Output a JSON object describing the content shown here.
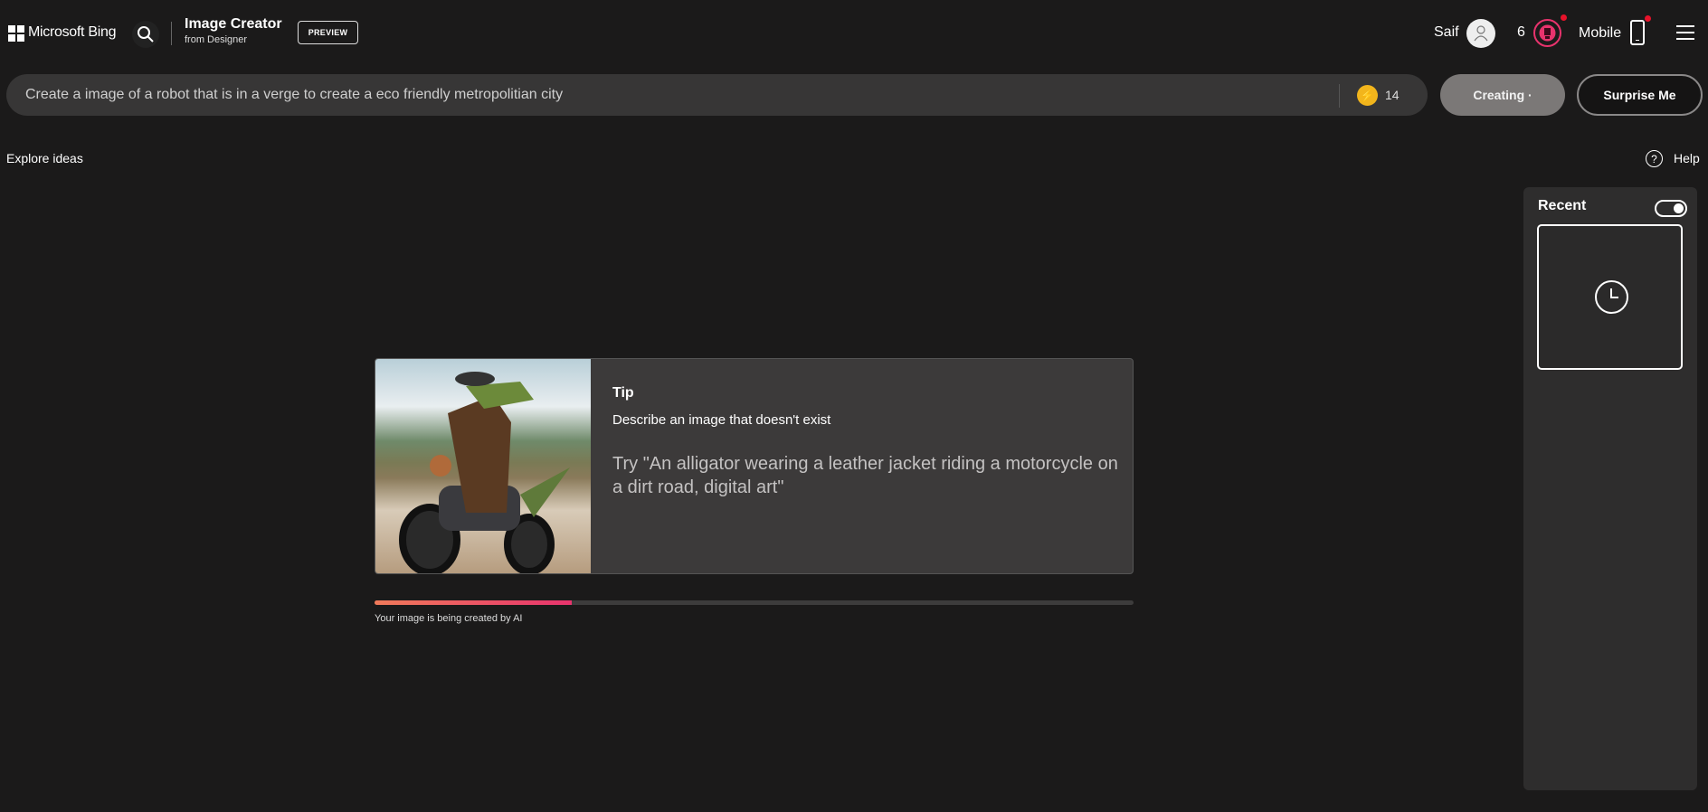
{
  "header": {
    "brand": "Microsoft Bing",
    "title": "Image Creator",
    "subtitle": "from Designer",
    "badge": "PREVIEW",
    "user_name": "Saif",
    "rewards_count": "6",
    "mobile_label": "Mobile"
  },
  "prompt": {
    "value": "Create a image of a robot that is in a verge to create a eco friendly metropolitian city",
    "boosts": "14",
    "create_label": "Creating ·",
    "surprise_label": "Surprise Me"
  },
  "explore_label": "Explore ideas",
  "help_label": "Help",
  "recent": {
    "title": "Recent",
    "toggle_on": true
  },
  "tip": {
    "label": "Tip",
    "description": "Describe an image that doesn't exist",
    "example": "Try \"An alligator wearing a leather jacket riding a motorcycle on a dirt road, digital art\""
  },
  "progress": {
    "fraction": 0.26,
    "caption": "Your image is being created by AI"
  },
  "colors": {
    "accent": "#e8336d",
    "background": "#1b1a1a",
    "coin": "#f2b51c"
  }
}
